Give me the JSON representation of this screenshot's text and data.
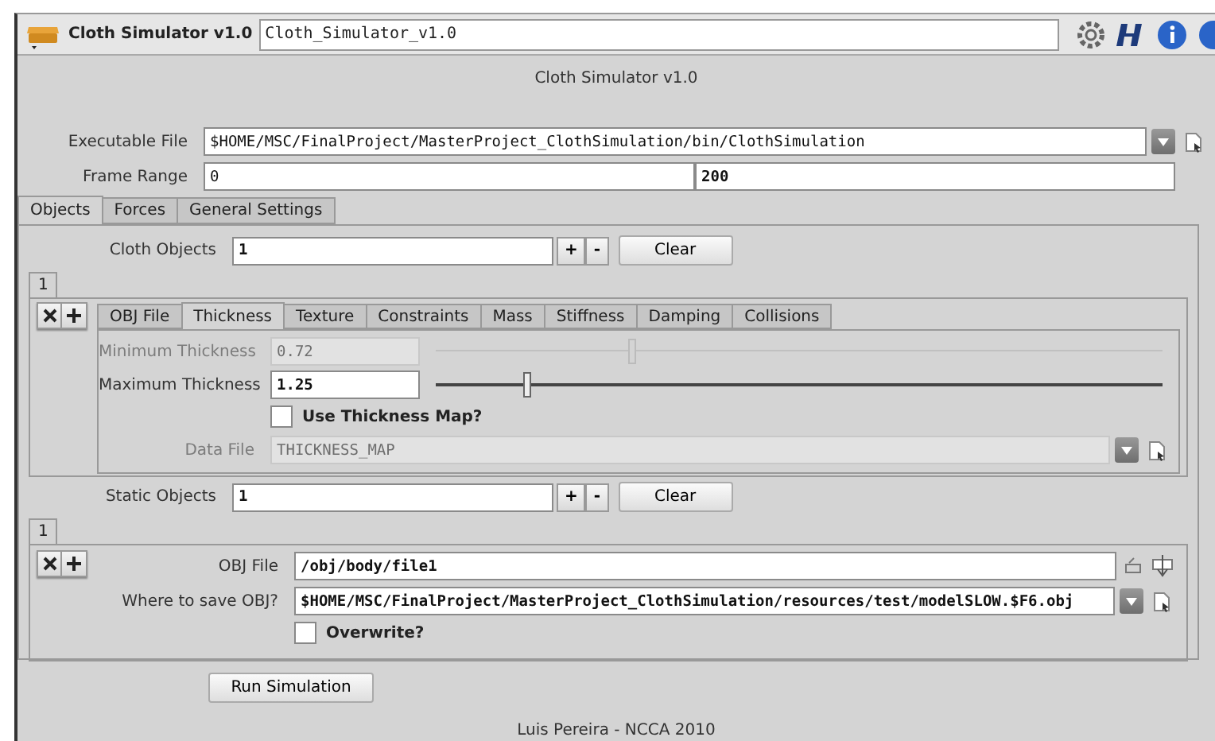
{
  "header": {
    "title": "Cloth Simulator v1.0",
    "name_value": "Cloth_Simulator_v1.0"
  },
  "panel_title": "Cloth Simulator v1.0",
  "executable": {
    "label": "Executable File",
    "value": "$HOME/MSC/FinalProject/MasterProject_ClothSimulation/bin/ClothSimulation"
  },
  "frame_range": {
    "label": "Frame Range",
    "start": "0",
    "end": "200"
  },
  "tabs": [
    {
      "label": "Objects",
      "selected": true
    },
    {
      "label": "Forces",
      "selected": false
    },
    {
      "label": "General Settings",
      "selected": false
    }
  ],
  "cloth_objects": {
    "label": "Cloth Objects",
    "value": "1",
    "increment": "+",
    "decrement": "-",
    "clear": "Clear",
    "instances": [
      {
        "label": "1",
        "selected": true
      }
    ]
  },
  "property_tabs": [
    {
      "label": "OBJ File",
      "selected": false
    },
    {
      "label": "Thickness",
      "selected": true
    },
    {
      "label": "Texture",
      "selected": false
    },
    {
      "label": "Constraints",
      "selected": false
    },
    {
      "label": "Mass",
      "selected": false
    },
    {
      "label": "Stiffness",
      "selected": false
    },
    {
      "label": "Damping",
      "selected": false
    },
    {
      "label": "Collisions",
      "selected": false
    }
  ],
  "thickness": [
    {
      "label": "Minimum Thickness",
      "value": "0.72",
      "disabled": true,
      "level": 0.27
    },
    {
      "label": "Maximum Thickness",
      "value": "1.25",
      "disabled": false,
      "level": 0.125
    }
  ],
  "use_thickness_map": {
    "label": "Use Thickness Map?",
    "checked": false
  },
  "data_file": {
    "label": "Data File",
    "value": "THICKNESS_MAP",
    "disabled": true
  },
  "static_objects": {
    "label": "Static Objects",
    "value": "1",
    "increment": "+",
    "decrement": "-",
    "clear": "Clear",
    "instances": [
      {
        "label": "1",
        "selected": true
      }
    ]
  },
  "obj_file": {
    "label": "OBJ File",
    "value": "/obj/body/file1"
  },
  "save_path": {
    "label": "Where to save OBJ?",
    "value": "$HOME/MSC/FinalProject/MasterProject_ClothSimulation/resources/test/modelSLOW.$F6.obj"
  },
  "overwrite": {
    "label": "Overwrite?",
    "checked": false
  },
  "run_button": "Run Simulation",
  "footer": "Luis Pereira - NCCA 2010"
}
